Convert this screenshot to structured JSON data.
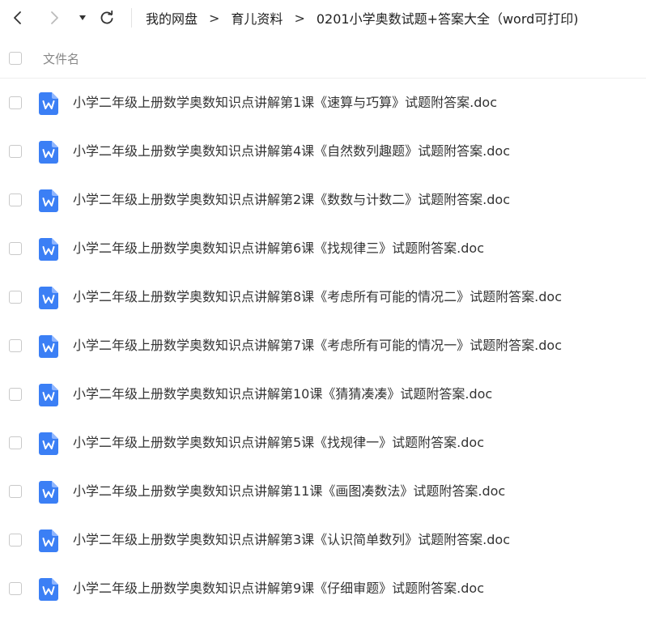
{
  "breadcrumb": {
    "items": [
      "我的网盘",
      "育儿资料"
    ],
    "separator": ">",
    "current": "0201小学奥数试题+答案大全（word可打印)"
  },
  "header": {
    "column_label": "文件名"
  },
  "files": [
    {
      "name": "小学二年级上册数学奥数知识点讲解第1课《速算与巧算》试题附答案.doc"
    },
    {
      "name": "小学二年级上册数学奥数知识点讲解第4课《自然数列趣题》试题附答案.doc"
    },
    {
      "name": "小学二年级上册数学奥数知识点讲解第2课《数数与计数二》试题附答案.doc"
    },
    {
      "name": "小学二年级上册数学奥数知识点讲解第6课《找规律三》试题附答案.doc"
    },
    {
      "name": "小学二年级上册数学奥数知识点讲解第8课《考虑所有可能的情况二》试题附答案.doc"
    },
    {
      "name": "小学二年级上册数学奥数知识点讲解第7课《考虑所有可能的情况一》试题附答案.doc"
    },
    {
      "name": "小学二年级上册数学奥数知识点讲解第10课《猜猜凑凑》试题附答案.doc"
    },
    {
      "name": "小学二年级上册数学奥数知识点讲解第5课《找规律一》试题附答案.doc"
    },
    {
      "name": "小学二年级上册数学奥数知识点讲解第11课《画图凑数法》试题附答案.doc"
    },
    {
      "name": "小学二年级上册数学奥数知识点讲解第3课《认识简单数列》试题附答案.doc"
    },
    {
      "name": "小学二年级上册数学奥数知识点讲解第9课《仔细审题》试题附答案.doc"
    }
  ],
  "icons": {
    "back": "chevron-left-icon",
    "forward": "chevron-right-icon",
    "history": "caret-down-icon",
    "refresh": "refresh-icon",
    "file": "word-doc-icon"
  },
  "colors": {
    "doc_icon": "#3b7ff5",
    "doc_icon_fold": "#8fb6ff",
    "text": "#333333",
    "muted": "#888888"
  }
}
